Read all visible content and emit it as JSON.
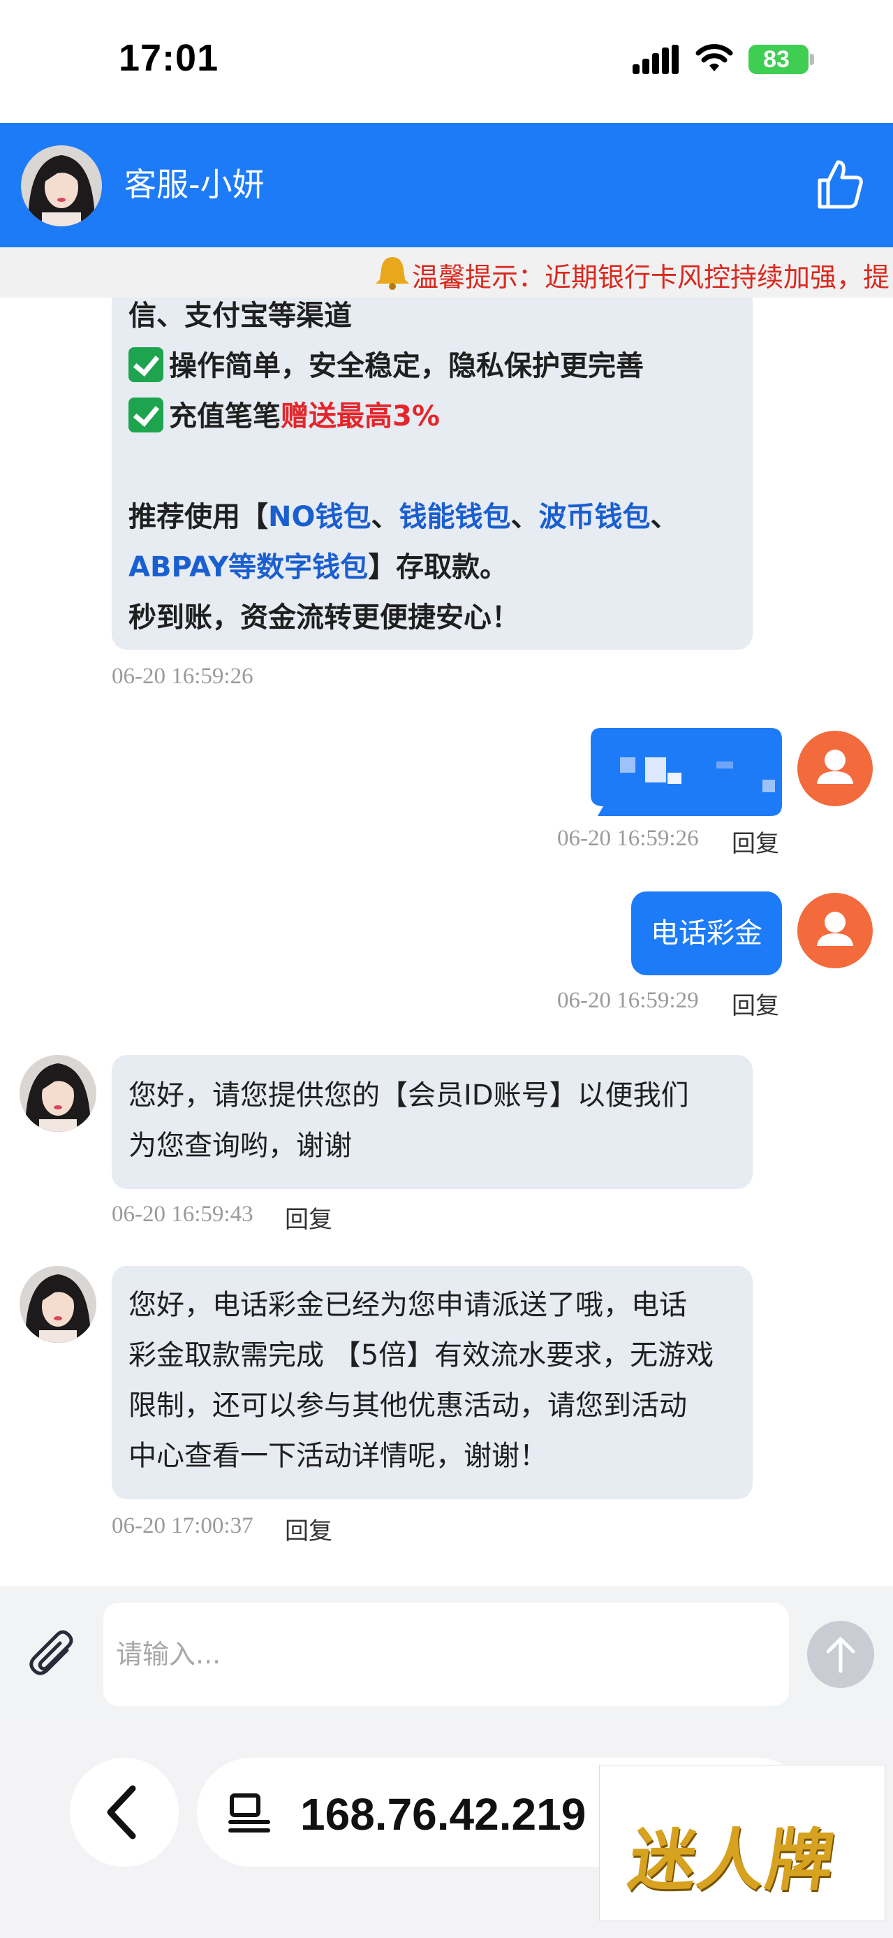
{
  "status_bar": {
    "time": "17:01",
    "battery": "83"
  },
  "header": {
    "title": "客服-小妍"
  },
  "notice": {
    "text": "温馨提示：近期银行卡风控持续加强，提"
  },
  "messages": {
    "first": {
      "line0": "信、支付宝等渠道",
      "line1": "操作简单，安全稳定，隐私保护更完善",
      "line2_a": "充值笔笔",
      "line2_b": "赠送最高3%",
      "line3_a": "推荐使用【",
      "line3_b": "NO钱包",
      "line3_c": "、",
      "line3_d": "钱能钱包",
      "line3_e": "、",
      "line3_f": "波币钱包",
      "line3_g": "、",
      "line4_a": "ABPAY等数字钱包",
      "line4_b": "】存取款。",
      "line5": "秒到账，资金流转更便捷安心！",
      "time": "06-20 16:59:26"
    },
    "user1": {
      "time": "06-20 16:59:26",
      "reply": "回复"
    },
    "user2": {
      "text": "电话彩金",
      "time": "06-20 16:59:29",
      "reply": "回复"
    },
    "agent1": {
      "line1": "您好，请您提供您的【会员ID账号】以便我们",
      "line2": "为您查询哟，谢谢",
      "time": "06-20 16:59:43",
      "reply": "回复"
    },
    "agent2": {
      "line1": "您好，电话彩金已经为您申请派送了哦，电话",
      "line2": "彩金取款需完成 【5倍】有效流水要求，无游戏",
      "line3": "限制，还可以参与其他优惠活动，请您到活动",
      "line4": "中心查看一下活动详情呢，谢谢！",
      "time": "06-20 17:00:37",
      "reply": "回复"
    }
  },
  "input": {
    "placeholder": "请输入..."
  },
  "browser": {
    "url": "168.76.42.219"
  },
  "watermark": {
    "text": "迷人牌"
  },
  "colors": {
    "brand_blue": "#1e7bf7",
    "notice_red": "#d9281e",
    "user_avatar": "#f36b3c"
  }
}
